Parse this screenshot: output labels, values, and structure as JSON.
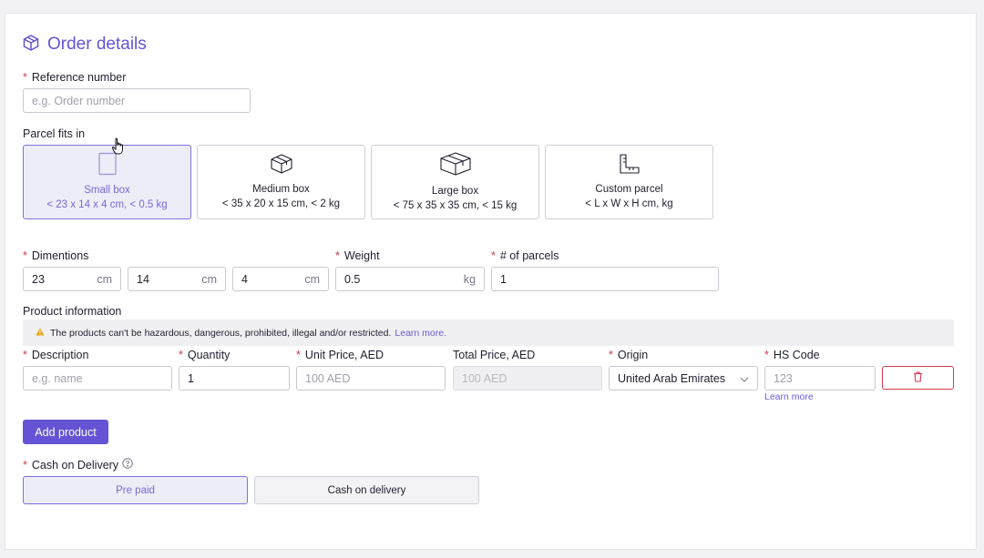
{
  "header": {
    "title": "Order details",
    "icon": "box-icon"
  },
  "reference": {
    "label": "Reference number",
    "placeholder": "e.g. Order number"
  },
  "parcel": {
    "label": "Parcel fits in",
    "options": [
      {
        "name": "Small box",
        "dims": "< 23 x 14 x 4 cm, < 0.5 kg",
        "selected": true
      },
      {
        "name": "Medium box",
        "dims": "< 35 x 20 x 15 cm, < 2 kg",
        "selected": false
      },
      {
        "name": "Large box",
        "dims": "< 75 x 35 x 35 cm, < 15 kg",
        "selected": false
      },
      {
        "name": "Custom parcel",
        "dims": "< L x W x H cm, kg",
        "selected": false
      }
    ]
  },
  "dimensions": {
    "label": "Dimentions",
    "length": "23",
    "width": "14",
    "height": "4",
    "unit": "cm"
  },
  "weight": {
    "label": "Weight",
    "value": "0.5",
    "unit": "kg"
  },
  "parcels": {
    "label": "# of parcels",
    "value": "1"
  },
  "product": {
    "section_label": "Product information",
    "warning_text": "The products can't be hazardous, dangerous, prohibited, illegal and/or restricted.",
    "warning_link": "Learn more.",
    "columns": {
      "description": "Description",
      "quantity": "Quantity",
      "unit_price": "Unit Price, AED",
      "total_price": "Total Price, AED",
      "origin": "Origin",
      "hs_code": "HS Code"
    },
    "row": {
      "description_placeholder": "e.g. name",
      "quantity": "1",
      "unit_price_placeholder": "100 AED",
      "total_price_placeholder": "100 AED",
      "origin": "United Arab Emirates",
      "hs_code_placeholder": "123",
      "hs_learn_more": "Learn more"
    },
    "add_button": "Add product"
  },
  "cod": {
    "label": "Cash on Delivery",
    "options": [
      {
        "label": "Pre paid",
        "selected": true
      },
      {
        "label": "Cash on delivery",
        "selected": false
      }
    ]
  },
  "colors": {
    "accent": "#6453d4",
    "required": "#d13a4c",
    "selected_bg": "#ededf7"
  }
}
